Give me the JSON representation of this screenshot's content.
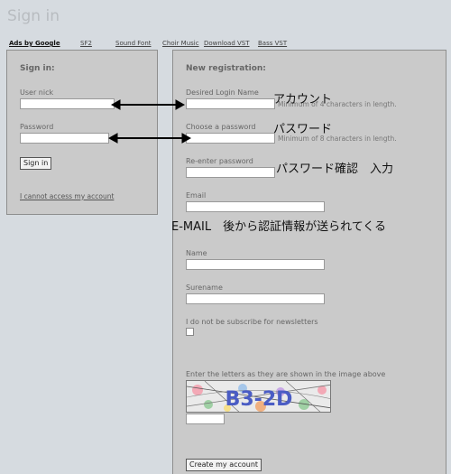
{
  "page_title": "Sign in",
  "adbar": {
    "ads_label": "Ads by Google",
    "links": [
      "SF2",
      "Sound Font",
      "Choir Music",
      "Download VST",
      "Bass VST"
    ]
  },
  "signin": {
    "heading": "Sign in:",
    "user_label": "User nick",
    "user_value": "",
    "password_label": "Password",
    "password_value": "",
    "button_label": "Sign in",
    "cannot_access_link": "I cannot access my account"
  },
  "register": {
    "heading": "New registration:",
    "login_label": "Desired Login Name",
    "login_hint": "Minimum of 4 characters in length.",
    "password_label": "Choose a password",
    "password_hint": "Minimum of 8 characters in length.",
    "reenter_label": "Re-enter password",
    "email_label": "Email",
    "name_label": "Name",
    "surname_label": "Surename",
    "newsletter_label": "I do not be subscribe for newsletters",
    "newsletter_checked": false,
    "captcha_label": "Enter the letters as they are shown in the image above",
    "captcha_text": "B3-2D",
    "create_button": "Create my account"
  },
  "annotations": {
    "account": "アカウント",
    "password": "パスワード",
    "password_confirm": "パスワード確認　入力",
    "email": "E-MAIL　後から認証情報が送られてくる"
  },
  "colors": {
    "page_bg": "#d6dbe0",
    "panel_bg": "#cacaca",
    "arrow": "#000000"
  }
}
